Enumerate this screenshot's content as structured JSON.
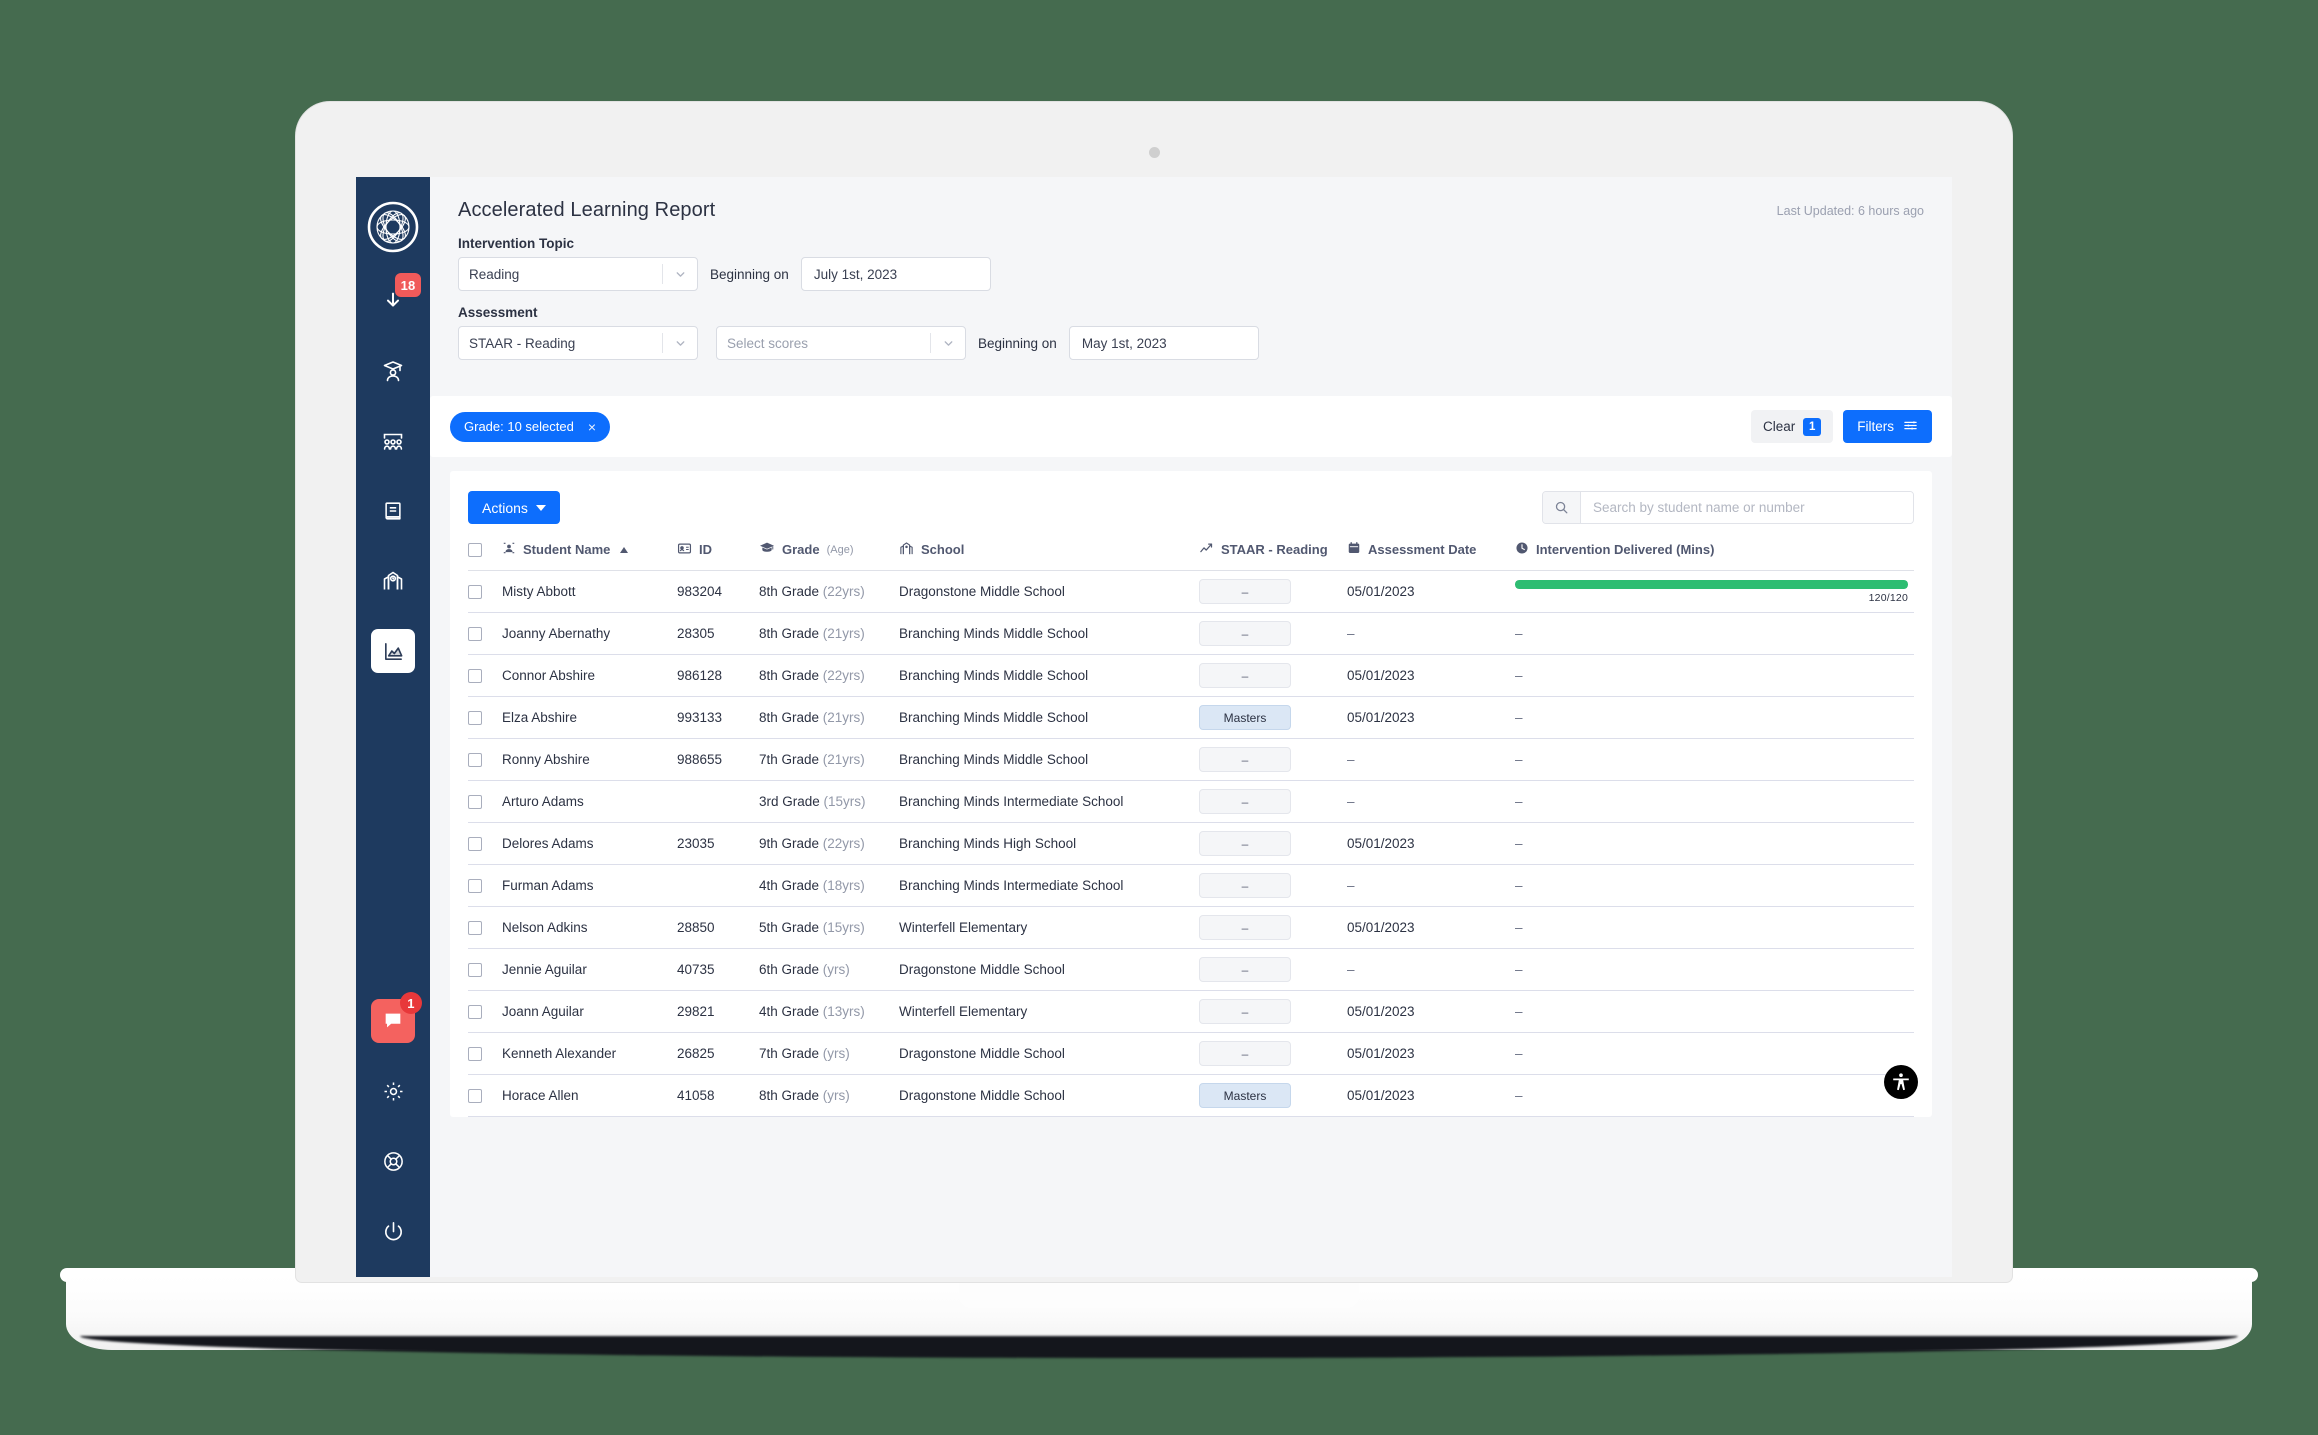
{
  "app": {
    "sidebar": {
      "logo_name": "branching-minds-logo",
      "items": [
        {
          "name": "notifications",
          "icon": "download-arrow-icon",
          "badge": "18"
        },
        {
          "name": "students",
          "icon": "student-graduate-icon",
          "badge": ""
        },
        {
          "name": "groups",
          "icon": "classroom-group-icon",
          "badge": ""
        },
        {
          "name": "library",
          "icon": "book-icon",
          "badge": ""
        },
        {
          "name": "schools",
          "icon": "school-building-icon",
          "badge": ""
        },
        {
          "name": "reports",
          "icon": "chart-area-icon",
          "badge": "",
          "active": true
        }
      ],
      "bottom_items": [
        {
          "name": "chat",
          "icon": "chat-bubble-icon",
          "badge": "1"
        },
        {
          "name": "settings",
          "icon": "gear-icon",
          "badge": ""
        },
        {
          "name": "help",
          "icon": "lifebuoy-icon",
          "badge": ""
        },
        {
          "name": "logout",
          "icon": "power-icon",
          "badge": ""
        }
      ]
    },
    "header": {
      "title": "Accelerated Learning Report",
      "last_updated": "Last Updated: 6 hours ago"
    },
    "filters": {
      "intervention_topic_label": "Intervention Topic",
      "intervention_topic_value": "Reading",
      "topic_beginning_label": "Beginning on",
      "topic_beginning_value": "July 1st, 2023",
      "assessment_label": "Assessment",
      "assessment_value": "STAAR - Reading",
      "scores_placeholder": "Select scores",
      "assessment_beginning_label": "Beginning on",
      "assessment_beginning_value": "May 1st, 2023"
    },
    "chips": {
      "grade_chip": "Grade: 10 selected",
      "chip_close": "×",
      "clear_label": "Clear",
      "clear_count": "1",
      "filters_label": "Filters"
    },
    "toolbar": {
      "actions_label": "Actions",
      "search_placeholder": "Search by student name or number"
    },
    "table": {
      "columns": [
        {
          "key": "checkbox",
          "label": "",
          "icon": ""
        },
        {
          "key": "name",
          "label": "Student Name",
          "icon": "user-avatar-icon",
          "sorted": "asc"
        },
        {
          "key": "id",
          "label": "ID",
          "icon": "id-card-icon"
        },
        {
          "key": "grade",
          "label": "Grade",
          "sub": "(Age)",
          "icon": "graduation-cap-icon"
        },
        {
          "key": "school",
          "label": "School",
          "icon": "school-icon"
        },
        {
          "key": "score",
          "label": "STAAR - Reading",
          "icon": "trend-chart-icon"
        },
        {
          "key": "date",
          "label": "Assessment Date",
          "icon": "calendar-icon"
        },
        {
          "key": "intervention",
          "label": "Intervention Delivered (Mins)",
          "icon": "clock-icon"
        }
      ],
      "rows": [
        {
          "name": "Misty Abbott",
          "id": "983204",
          "grade": "8th Grade",
          "age": "(22yrs)",
          "school": "Dragonstone Middle School",
          "score": "–",
          "score_type": "none",
          "date": "05/01/2023",
          "progress": 100,
          "progress_label": "120/120"
        },
        {
          "name": "Joanny Abernathy",
          "id": "28305",
          "grade": "8th Grade",
          "age": "(21yrs)",
          "school": "Branching Minds Middle School",
          "score": "–",
          "score_type": "none",
          "date": "–",
          "progress": null,
          "progress_label": "–"
        },
        {
          "name": "Connor Abshire",
          "id": "986128",
          "grade": "8th Grade",
          "age": "(22yrs)",
          "school": "Branching Minds Middle School",
          "score": "–",
          "score_type": "none",
          "date": "05/01/2023",
          "progress": null,
          "progress_label": "–"
        },
        {
          "name": "Elza Abshire",
          "id": "993133",
          "grade": "8th Grade",
          "age": "(21yrs)",
          "school": "Branching Minds Middle School",
          "score": "Masters",
          "score_type": "masters",
          "date": "05/01/2023",
          "progress": null,
          "progress_label": "–"
        },
        {
          "name": "Ronny Abshire",
          "id": "988655",
          "grade": "7th Grade",
          "age": "(21yrs)",
          "school": "Branching Minds Middle School",
          "score": "–",
          "score_type": "none",
          "date": "–",
          "progress": null,
          "progress_label": "–"
        },
        {
          "name": "Arturo Adams",
          "id": "",
          "grade": "3rd Grade",
          "age": "(15yrs)",
          "school": "Branching Minds Intermediate School",
          "score": "–",
          "score_type": "none",
          "date": "–",
          "progress": null,
          "progress_label": "–"
        },
        {
          "name": "Delores Adams",
          "id": "23035",
          "grade": "9th Grade",
          "age": "(22yrs)",
          "school": "Branching Minds High School",
          "score": "–",
          "score_type": "none",
          "date": "05/01/2023",
          "progress": null,
          "progress_label": "–"
        },
        {
          "name": "Furman Adams",
          "id": "",
          "grade": "4th Grade",
          "age": "(18yrs)",
          "school": "Branching Minds Intermediate School",
          "score": "–",
          "score_type": "none",
          "date": "–",
          "progress": null,
          "progress_label": "–"
        },
        {
          "name": "Nelson Adkins",
          "id": "28850",
          "grade": "5th Grade",
          "age": "(15yrs)",
          "school": "Winterfell Elementary",
          "score": "–",
          "score_type": "none",
          "date": "05/01/2023",
          "progress": null,
          "progress_label": "–"
        },
        {
          "name": "Jennie Aguilar",
          "id": "40735",
          "grade": "6th Grade",
          "age": "(yrs)",
          "school": "Dragonstone Middle School",
          "score": "–",
          "score_type": "none",
          "date": "–",
          "progress": null,
          "progress_label": "–"
        },
        {
          "name": "Joann Aguilar",
          "id": "29821",
          "grade": "4th Grade",
          "age": "(13yrs)",
          "school": "Winterfell Elementary",
          "score": "–",
          "score_type": "none",
          "date": "05/01/2023",
          "progress": null,
          "progress_label": "–"
        },
        {
          "name": "Kenneth Alexander",
          "id": "26825",
          "grade": "7th Grade",
          "age": "(yrs)",
          "school": "Dragonstone Middle School",
          "score": "–",
          "score_type": "none",
          "date": "05/01/2023",
          "progress": null,
          "progress_label": "–"
        },
        {
          "name": "Horace Allen",
          "id": "41058",
          "grade": "8th Grade",
          "age": "(yrs)",
          "school": "Dragonstone Middle School",
          "score": "Masters",
          "score_type": "masters",
          "date": "05/01/2023",
          "progress": null,
          "progress_label": "–"
        }
      ]
    },
    "accessibility_button": "accessibility-icon",
    "colors": {
      "background": "#456b4f",
      "sidebar": "#1e3a5f",
      "accent": "#0d6efd",
      "progress_green": "#2ebd72",
      "badge_red": "#f05a5a",
      "masters_blue": "#dbe7f5"
    }
  }
}
